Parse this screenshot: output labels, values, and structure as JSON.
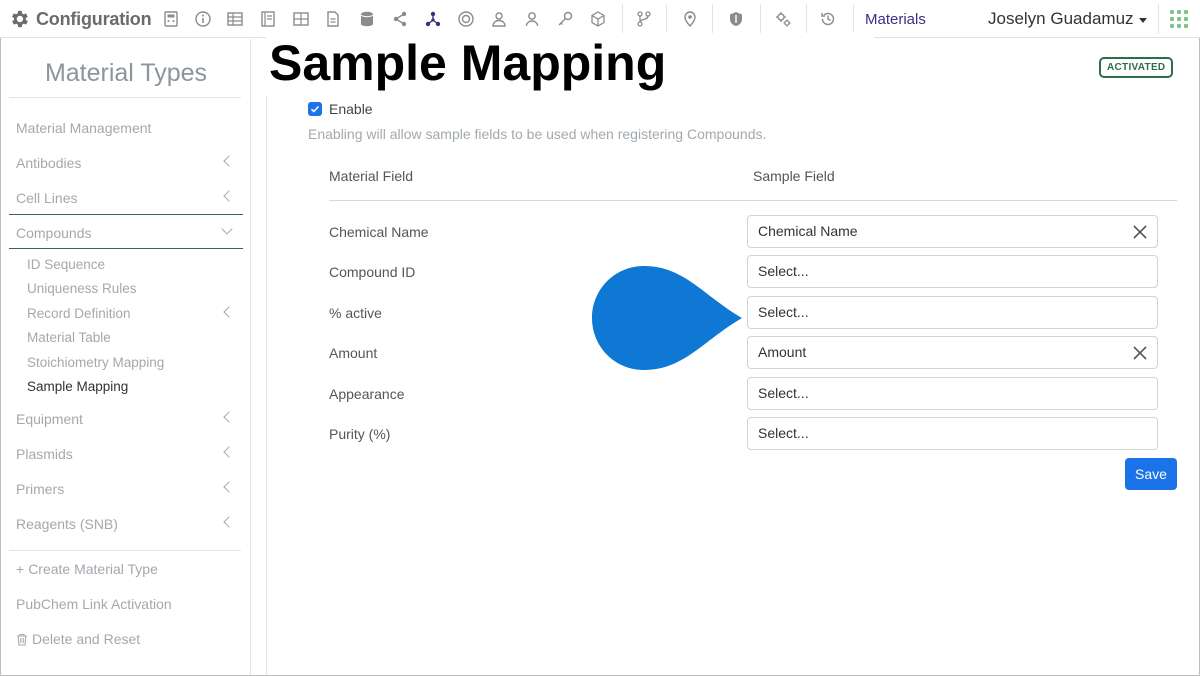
{
  "header": {
    "brand_title": "Configuration",
    "toolbar_icons": [
      "gear-icon",
      "calculator-icon",
      "info-icon",
      "table-icon",
      "notebook-icon",
      "grid-icon",
      "document-icon",
      "database-icon",
      "share-icon",
      "molecule-icon",
      "badge-icon",
      "users-icon",
      "user-icon",
      "key-icon",
      "cube-icon",
      "branch-icon",
      "location-icon",
      "shield-icon",
      "settings-icon",
      "history-icon",
      "apps-icon"
    ],
    "materials_link": "Materials",
    "user_name": "Joselyn Guadamuz"
  },
  "sidebar": {
    "title": "Material Types",
    "items": [
      {
        "label": "Material Management"
      },
      {
        "label": "Antibodies"
      },
      {
        "label": "Cell Lines"
      },
      {
        "label": "Compounds"
      }
    ],
    "compound_subitems": [
      {
        "label": "ID Sequence"
      },
      {
        "label": "Uniqueness Rules"
      },
      {
        "label": "Record Definition"
      },
      {
        "label": "Material Table"
      },
      {
        "label": "Stoichiometry Mapping"
      },
      {
        "label": "Sample Mapping"
      }
    ],
    "items_after": [
      {
        "label": "Equipment"
      },
      {
        "label": "Plasmids"
      },
      {
        "label": "Primers"
      },
      {
        "label": "Reagents (SNB)"
      }
    ],
    "actions": [
      {
        "label": "Create Material Type"
      },
      {
        "label": "PubChem Link Activation"
      },
      {
        "label": "Delete and Reset"
      }
    ]
  },
  "main": {
    "page_title": "Sample Mapping",
    "status_badge": "ACTIVATED",
    "enable_label": "Enable",
    "enable_checked": true,
    "help_text": "Enabling will allow sample fields to be used when registering Compounds.",
    "col_material": "Material Field",
    "col_sample": "Sample Field",
    "rows": [
      {
        "material": "Chemical Name",
        "sample": "Chemical Name",
        "clearable": true
      },
      {
        "material": "Compound ID",
        "sample": "Select...",
        "clearable": false
      },
      {
        "material": "% active",
        "sample": "Select...",
        "clearable": false
      },
      {
        "material": "Amount",
        "sample": "Amount",
        "clearable": true
      },
      {
        "material": "Appearance",
        "sample": "Select...",
        "clearable": false
      },
      {
        "material": "Purity (%)",
        "sample": "Select...",
        "clearable": false
      }
    ],
    "save_label": "Save"
  },
  "colors": {
    "accent": "#1a73e8",
    "brand_purple": "#3f2d86",
    "activated_green": "#2c6e49",
    "pointer_blue": "#0f78d4"
  }
}
